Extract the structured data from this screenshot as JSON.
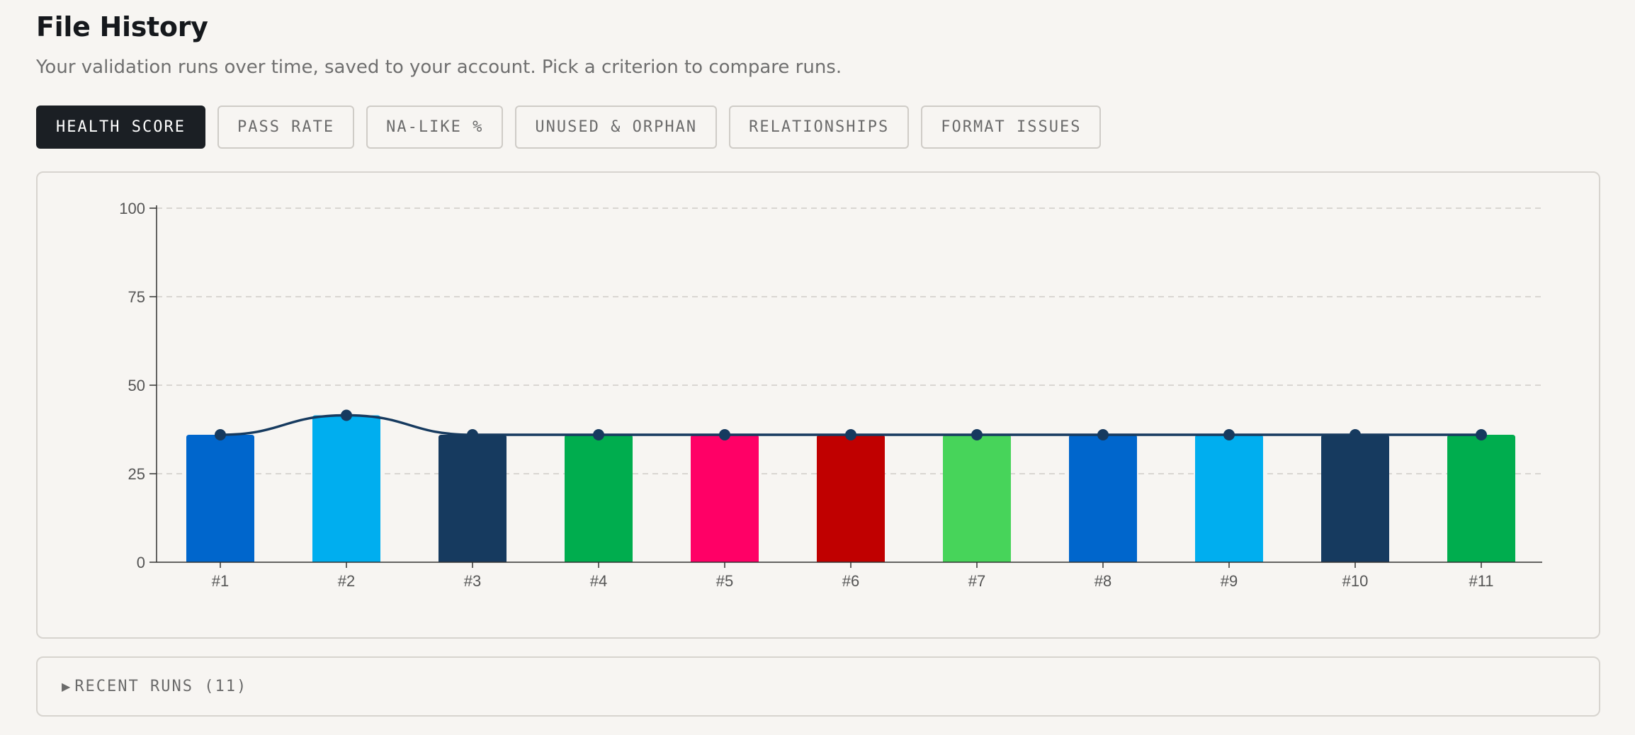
{
  "page": {
    "title": "File History",
    "subtitle": "Your validation runs over time, saved to your account. Pick a criterion to compare runs."
  },
  "tabs": [
    {
      "label": "HEALTH SCORE",
      "active": true
    },
    {
      "label": "PASS RATE",
      "active": false
    },
    {
      "label": "NA-LIKE %",
      "active": false
    },
    {
      "label": "UNUSED & ORPHAN",
      "active": false
    },
    {
      "label": "RELATIONSHIPS",
      "active": false
    },
    {
      "label": "FORMAT ISSUES",
      "active": false
    }
  ],
  "chart_data": {
    "type": "bar",
    "categories": [
      "#1",
      "#2",
      "#3",
      "#4",
      "#5",
      "#6",
      "#7",
      "#8",
      "#9",
      "#10",
      "#11"
    ],
    "values": [
      36,
      41.5,
      36,
      36,
      36,
      36,
      36,
      36,
      36,
      36,
      36
    ],
    "bar_colors": [
      "#0066cc",
      "#00aeef",
      "#163a5f",
      "#00ad4e",
      "#ff0066",
      "#c00000",
      "#47d45a",
      "#0066cc",
      "#00aeef",
      "#163a5f",
      "#00ad4e"
    ],
    "line_color": "#163a5f",
    "ylim": [
      0,
      100
    ],
    "yticks": [
      0,
      25,
      50,
      75,
      100
    ],
    "grid": true
  },
  "recent_runs": {
    "caret": "▶",
    "label": "RECENT RUNS (11)"
  },
  "colors": {
    "background": "#f7f5f2",
    "active_tab": "#1b1f24",
    "border": "#d7d4cf"
  }
}
